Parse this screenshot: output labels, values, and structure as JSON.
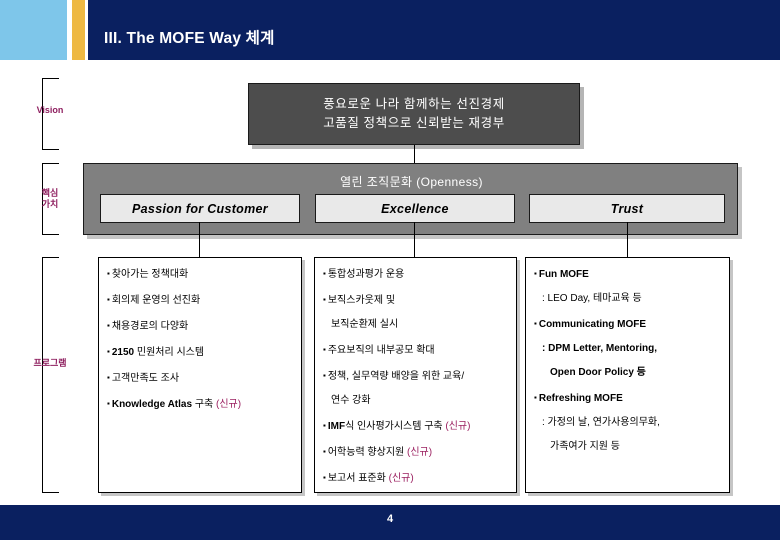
{
  "header": {
    "title": "III. The MOFE Way 체계",
    "navy": "#0a2060",
    "accent_blue": "#7ec6ea",
    "accent_gold": "#eeb943"
  },
  "footer": {
    "page_number": "4",
    "color": "#0a2060"
  },
  "rows": [
    {
      "label": "Vision"
    },
    {
      "label": "핵심\n가치"
    },
    {
      "label": "프로그램"
    }
  ],
  "vision": {
    "lines": [
      "풍요로운 나라 함께하는 선진경제",
      "고품질 정책으로 신뢰받는 재경부"
    ],
    "bg": "#4d4d4d"
  },
  "core_values": {
    "title": "열린 조직문화 (Openness)",
    "bar_bg": "#808080",
    "boxes": [
      {
        "label": "Passion for Customer"
      },
      {
        "label": "Excellence"
      },
      {
        "label": "Trust"
      }
    ]
  },
  "new_tag": "(신규)",
  "new_tag_color": "#9b2060",
  "programs": [
    {
      "column": "Passion for Customer",
      "items": [
        {
          "text": "찾아가는 정책대화"
        },
        {
          "text": "회의제 운영의 선진화"
        },
        {
          "text": "채용경로의 다양화"
        },
        {
          "text": "2150 민원처리 시스템",
          "bold_prefix": "2150",
          "rest": " 민원처리 시스템"
        },
        {
          "text": "고객만족도 조사"
        },
        {
          "text": "Knowledge Atlas 구축 (신규)",
          "bold_prefix": "Knowledge Atlas",
          "rest": " 구축 ",
          "new": "(신규)"
        }
      ]
    },
    {
      "column": "Excellence",
      "items": [
        {
          "text": "통합성과평가 운용"
        },
        {
          "text": "보직스카웃제 및",
          "continuation": "보직순환제 실시"
        },
        {
          "text": "주요보직의 내부공모 확대"
        },
        {
          "text": "정책, 실무역량 배양을 위한 교육/",
          "continuation": "연수 강화"
        },
        {
          "text": "IMF식 인사평가시스템 구축 (신규)",
          "bold_prefix": "IMF",
          "rest": "식 인사평가시스템 구축 ",
          "new": "(신규)"
        },
        {
          "text": "어학능력 향상지원 (신규)",
          "rest": "어학능력 향상지원 ",
          "new": "(신규)"
        },
        {
          "text": "보고서 표준화 (신규)",
          "rest": "보고서 표준화 ",
          "new": "(신규)"
        }
      ]
    },
    {
      "column": "Trust",
      "items": [
        {
          "text": "Fun MOFE",
          "bold_prefix": "Fun MOFE",
          "continuation": ": LEO Day, 테마교육 등"
        },
        {
          "text": "Communicating MOFE",
          "bold_prefix": "Communicating MOFE",
          "continuation": ": DPM Letter, Mentoring,",
          "continuation2": "Open Door Policy 등"
        },
        {
          "text": "Refreshing MOFE",
          "bold_prefix": "Refreshing MOFE",
          "continuation": ": 가정의 날, 연가사용의무화,",
          "continuation2": "가족여가 지원 등"
        }
      ]
    }
  ]
}
